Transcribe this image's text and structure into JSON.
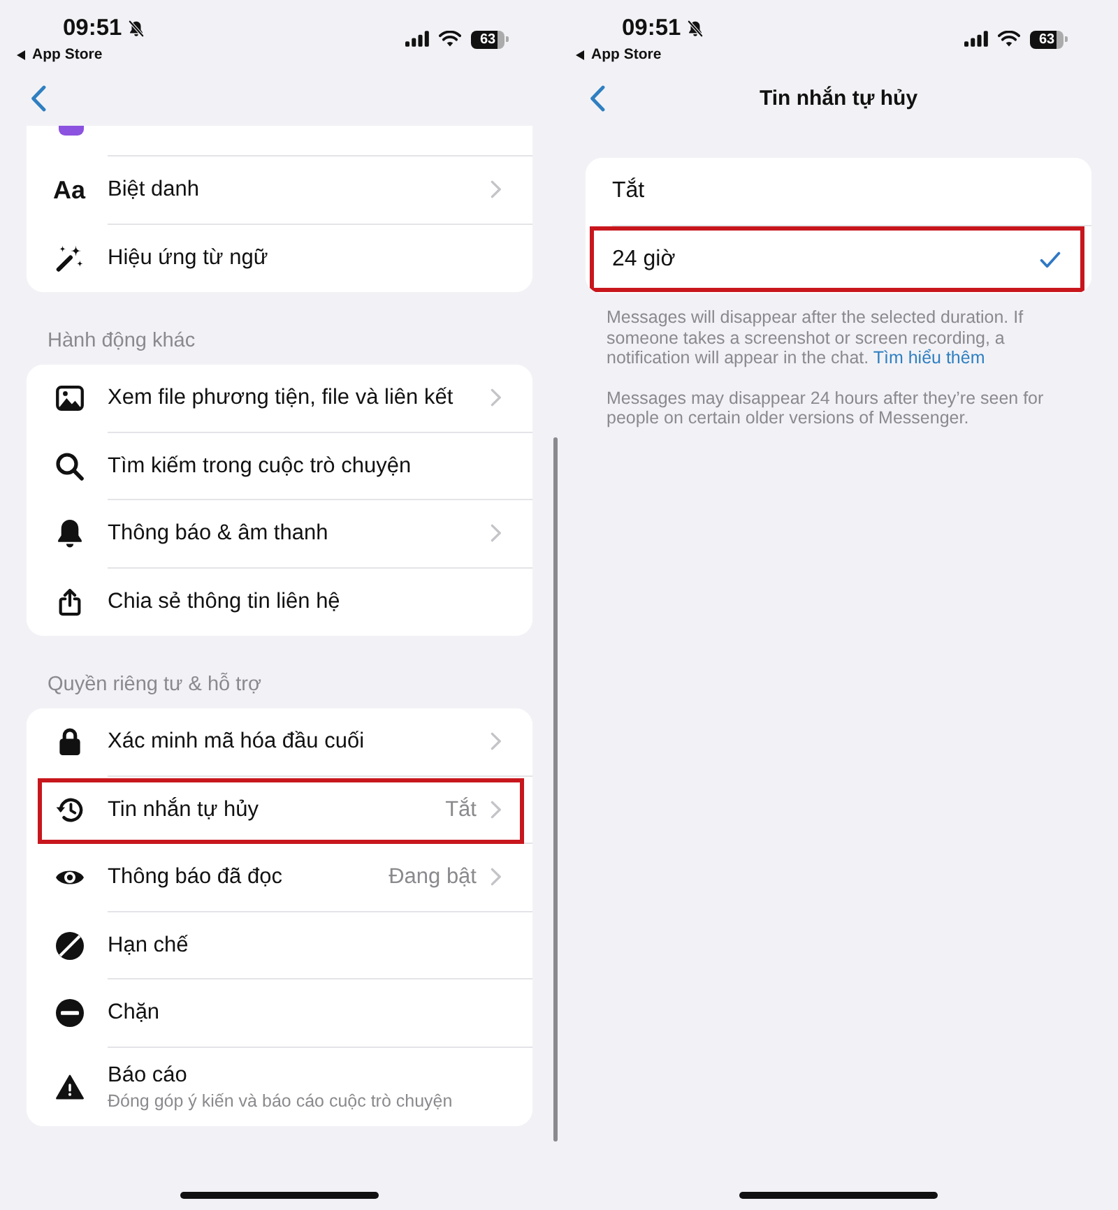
{
  "screens": [
    {
      "kind": "settings",
      "status_bar": {
        "time": "09:51",
        "back_app": "App Store",
        "battery": "63"
      },
      "sections": [
        {
          "items": [
            {
              "kind": "partial"
            },
            {
              "kind": "row",
              "glyph": "Aa",
              "label": "Biệt danh",
              "chevron": true,
              "highlighted": false
            },
            {
              "kind": "row",
              "label": "Hiệu ứng từ ngữ",
              "chevron": false,
              "highlighted": false
            }
          ]
        },
        {
          "header": "Hành động khác",
          "items": [
            {
              "kind": "row",
              "label": "Xem file phương tiện, file và liên kết",
              "chevron": true,
              "highlighted": false
            },
            {
              "kind": "row",
              "label": "Tìm kiếm trong cuộc trò chuyện",
              "chevron": false,
              "highlighted": false
            },
            {
              "kind": "row",
              "label": "Thông báo & âm thanh",
              "chevron": true,
              "highlighted": false
            },
            {
              "kind": "row",
              "label": "Chia sẻ thông tin liên hệ",
              "chevron": false,
              "highlighted": false
            }
          ]
        },
        {
          "header": "Quyền riêng tư & hỗ trợ",
          "items": [
            {
              "kind": "row",
              "label": "Xác minh mã hóa đầu cuối",
              "chevron": true,
              "highlighted": false
            },
            {
              "kind": "row",
              "label": "Tin nhắn tự hủy",
              "value": "Tắt",
              "chevron": true,
              "highlighted": true
            },
            {
              "kind": "row",
              "label": "Thông báo đã đọc",
              "value": "Đang bật",
              "chevron": true,
              "highlighted": false
            },
            {
              "kind": "row",
              "label": "Hạn chế",
              "chevron": false,
              "highlighted": false
            },
            {
              "kind": "row",
              "label": "Chặn",
              "chevron": false,
              "highlighted": false
            },
            {
              "kind": "row",
              "label": "Báo cáo",
              "subtitle": "Đóng góp ý kiến và báo cáo cuộc trò chuyện",
              "chevron": false,
              "highlighted": false
            }
          ]
        }
      ]
    },
    {
      "kind": "picker",
      "status_bar": {
        "time": "09:51",
        "back_app": "App Store",
        "battery": "63"
      },
      "title": "Tin nhắn tự hủy",
      "options": [
        {
          "label": "Tắt",
          "selected": false,
          "highlighted": false
        },
        {
          "label": "24 giờ",
          "selected": true,
          "highlighted": true
        }
      ],
      "notes": [
        {
          "text": "Messages will disappear after the selected duration. If someone takes a screenshot or screen recording, a notification will appear in the chat.",
          "link": "Tìm hiểu thêm"
        },
        {
          "text": "Messages may disappear 24 hours after they’re seen for people on certain older versions of Messenger."
        }
      ]
    }
  ]
}
